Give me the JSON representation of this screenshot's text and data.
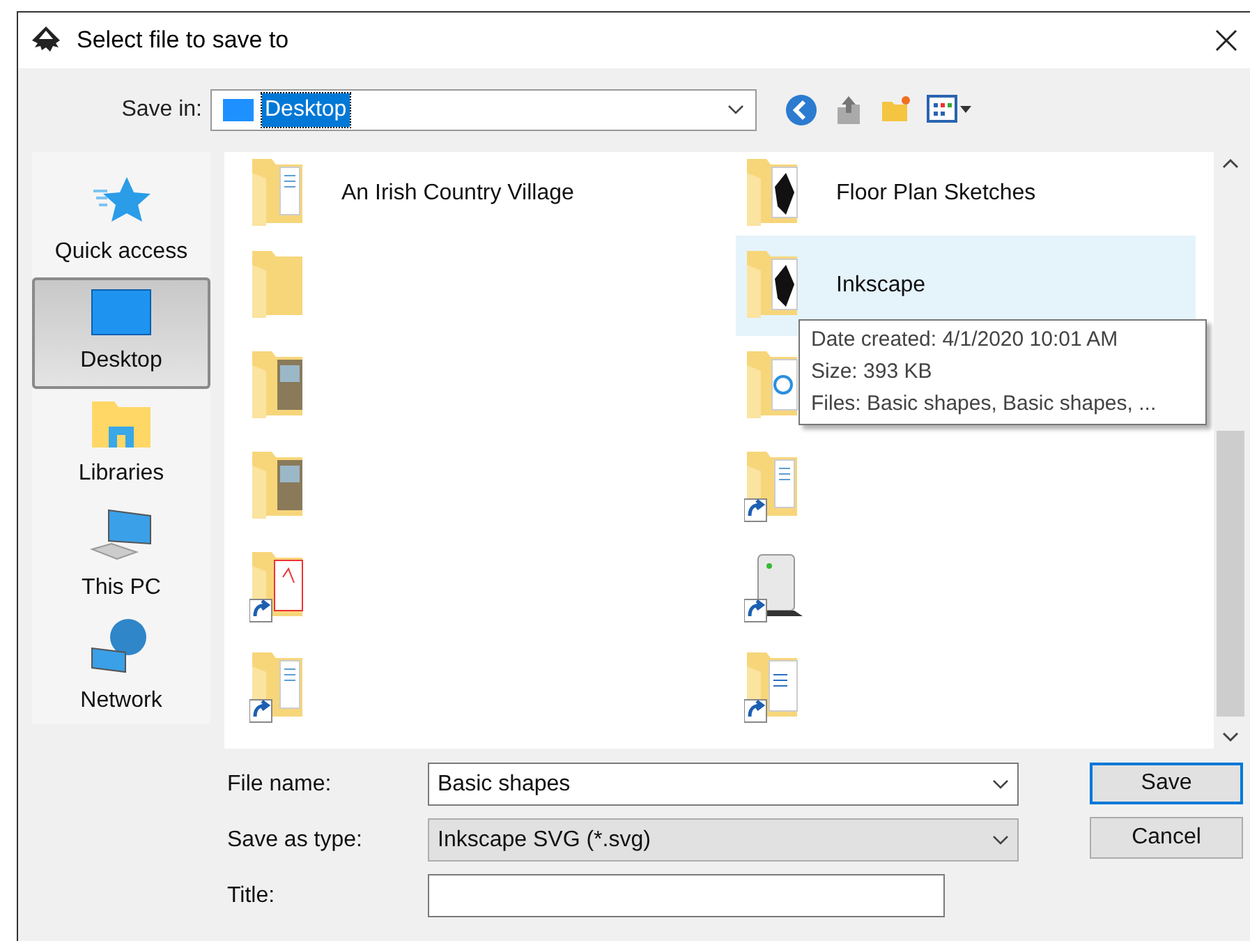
{
  "window": {
    "title": "Select file to save to"
  },
  "toolbar": {
    "save_in_label": "Save in:",
    "location": "Desktop"
  },
  "places": [
    {
      "label": "Quick access",
      "kind": "star",
      "selected": false
    },
    {
      "label": "Desktop",
      "kind": "desktop",
      "selected": true
    },
    {
      "label": "Libraries",
      "kind": "libraries",
      "selected": false
    },
    {
      "label": "This PC",
      "kind": "pc",
      "selected": false
    },
    {
      "label": "Network",
      "kind": "network",
      "selected": false
    }
  ],
  "files": [
    {
      "label": "An Irish Country Village",
      "kind": "docs",
      "shortcut": false,
      "selected": false
    },
    {
      "label": "Floor Plan Sketches",
      "kind": "dark",
      "shortcut": false,
      "selected": false
    },
    {
      "kind": "empty",
      "shortcut": false,
      "selected": false
    },
    {
      "label": "Inkscape",
      "kind": "dark",
      "shortcut": false,
      "selected": true
    },
    {
      "kind": "photo",
      "shortcut": false,
      "selected": false
    },
    {
      "kind": "circle",
      "shortcut": false,
      "selected": false
    },
    {
      "kind": "photo",
      "shortcut": false,
      "selected": false
    },
    {
      "kind": "docs",
      "shortcut": true,
      "selected": false
    },
    {
      "kind": "pdf",
      "shortcut": true,
      "selected": false
    },
    {
      "kind": "server",
      "shortcut": true,
      "selected": false
    },
    {
      "kind": "docs",
      "shortcut": true,
      "selected": false
    },
    {
      "kind": "word",
      "shortcut": true,
      "selected": false
    }
  ],
  "tooltip": [
    "Date created: 4/1/2020 10:01 AM",
    "Size: 393 KB",
    "Files: Basic shapes, Basic shapes, ..."
  ],
  "form": {
    "file_name_label": "File name:",
    "file_name": "Basic shapes",
    "type_label": "Save as type:",
    "type": "Inkscape SVG (*.svg)",
    "title_label": "Title:"
  },
  "buttons": [
    {
      "label": "Save",
      "default": true
    },
    {
      "label": "Cancel",
      "default": false
    }
  ]
}
